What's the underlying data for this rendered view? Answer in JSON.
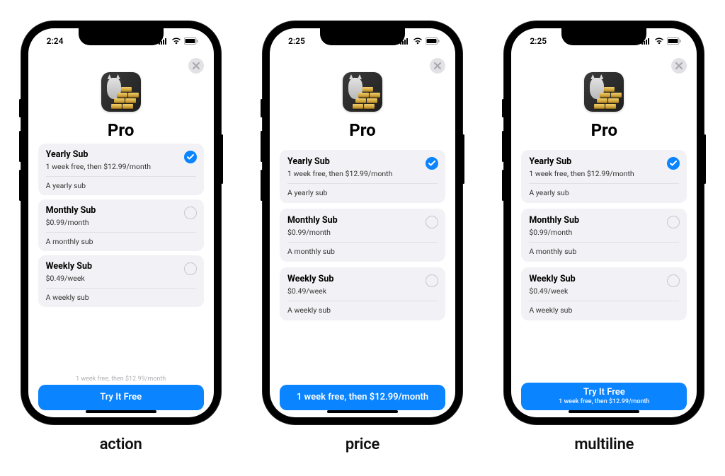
{
  "captions": [
    "action",
    "price",
    "multiline"
  ],
  "phones": [
    {
      "time": "2:24",
      "title": "Pro",
      "hint_above": "1 week free, then $12.99/month",
      "cta_primary": "Try It Free",
      "cta_secondary": "",
      "plans": [
        {
          "name": "Yearly Sub",
          "price": "1 week free, then $12.99/month",
          "desc": "A yearly sub",
          "selected": true
        },
        {
          "name": "Monthly Sub",
          "price": "$0.99/month",
          "desc": "A monthly sub",
          "selected": false
        },
        {
          "name": "Weekly Sub",
          "price": "$0.49/week",
          "desc": "A weekly sub",
          "selected": false
        }
      ]
    },
    {
      "time": "2:25",
      "title": "Pro",
      "hint_above": "",
      "cta_primary": "1 week free, then $12.99/month",
      "cta_secondary": "",
      "plans": [
        {
          "name": "Yearly Sub",
          "price": "1 week free, then $12.99/month",
          "desc": "A yearly sub",
          "selected": true
        },
        {
          "name": "Monthly Sub",
          "price": "$0.99/month",
          "desc": "A monthly sub",
          "selected": false
        },
        {
          "name": "Weekly Sub",
          "price": "$0.49/week",
          "desc": "A weekly sub",
          "selected": false
        }
      ]
    },
    {
      "time": "2:25",
      "title": "Pro",
      "hint_above": "",
      "cta_primary": "Try It Free",
      "cta_secondary": "1 week free, then $12.99/month",
      "plans": [
        {
          "name": "Yearly Sub",
          "price": "1 week free, then $12.99/month",
          "desc": "A yearly sub",
          "selected": true
        },
        {
          "name": "Monthly Sub",
          "price": "$0.99/month",
          "desc": "A monthly sub",
          "selected": false
        },
        {
          "name": "Weekly Sub",
          "price": "$0.49/week",
          "desc": "A weekly sub",
          "selected": false
        }
      ]
    }
  ],
  "colors": {
    "accent": "#0a84ff",
    "card_bg": "#f2f2f6"
  }
}
